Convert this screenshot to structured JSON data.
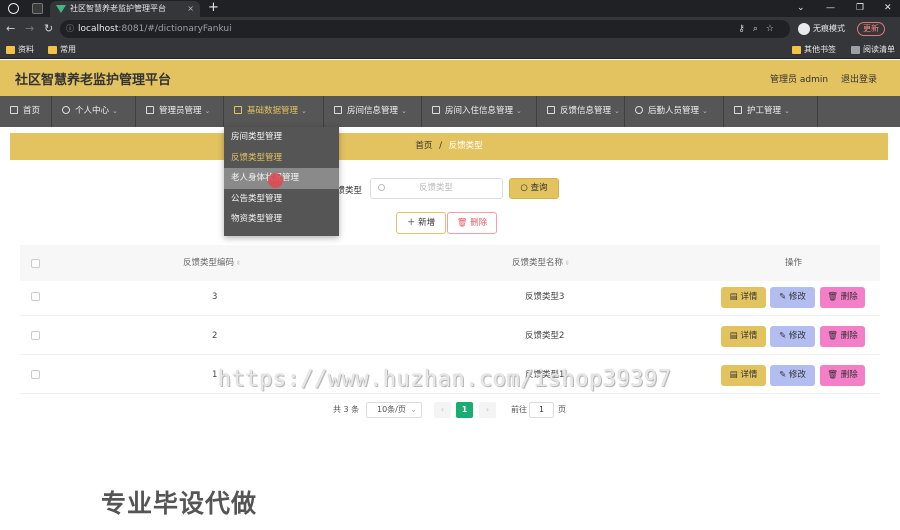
{
  "browser": {
    "tab_title": "社区智慧养老监护管理平台",
    "tab_close": "×",
    "new_tab": "+",
    "url_host": "localhost",
    "url_rest": ":8081/#/dictionaryFankui",
    "incognito_label": "无痕模式",
    "update_label": "更新",
    "win_min": "—",
    "win_max": "❐",
    "win_close": "✕",
    "win_chevron": "⌄",
    "bookmarks": [
      "资料",
      "常用"
    ],
    "bookmarks_right": [
      "其他书签",
      "阅读清单"
    ]
  },
  "header": {
    "title": "社区智慧养老监护管理平台",
    "admin_info": "管理员 admin",
    "logout": "退出登录"
  },
  "menu": [
    {
      "label": "首页"
    },
    {
      "label": "个人中心"
    },
    {
      "label": "管理员管理"
    },
    {
      "label": "基础数据管理"
    },
    {
      "label": "房间信息管理"
    },
    {
      "label": "房间入住信息管理"
    },
    {
      "label": "反馈信息管理"
    },
    {
      "label": "后勤人员管理"
    },
    {
      "label": "护工管理"
    }
  ],
  "dropdown": [
    "房间类型管理",
    "反馈类型管理",
    "老人身体状况管理",
    "公告类型管理",
    "物资类型管理"
  ],
  "breadcrumb": {
    "home": "首页",
    "sep": "/",
    "current": "反馈类型"
  },
  "search": {
    "label": "反馈类型",
    "placeholder": "反馈类型",
    "query_button": "查询"
  },
  "actions": {
    "add": "新增",
    "delete": "删除"
  },
  "table": {
    "headers": [
      "反馈类型编码",
      "反馈类型名称",
      "操作"
    ],
    "rows": [
      {
        "code": "3",
        "name": "反馈类型3"
      },
      {
        "code": "2",
        "name": "反馈类型2"
      },
      {
        "code": "1",
        "name": "反馈类型1"
      }
    ],
    "row_buttons": {
      "detail": "详情",
      "edit": "修改",
      "delete": "删除"
    }
  },
  "pagination": {
    "total": "共 3 条",
    "page_size": "10条/页",
    "current_page": "1",
    "goto_label": "前往",
    "goto_value": "1",
    "page_unit": "页"
  },
  "overlay": {
    "watermark": "https://www.huzhan.com/ishop39397",
    "promo": "专业毕设代做"
  },
  "colors": {
    "accent": "#e3c260",
    "menubar": "#565656",
    "pager_active": "#1aad72",
    "edit": "#b3bdf0",
    "delete": "#f27fc8"
  }
}
